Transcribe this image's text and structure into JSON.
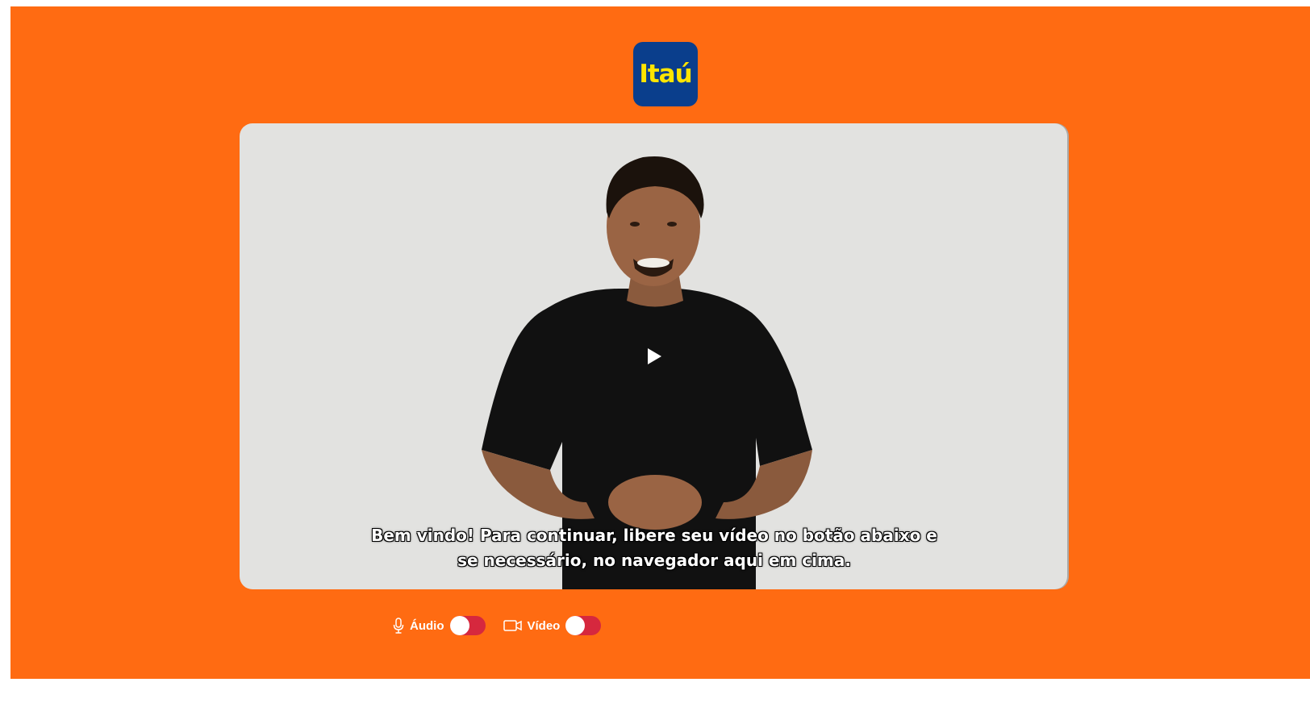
{
  "brand": {
    "logo_text": "Itaú",
    "logo_bg": "#0a3e8c",
    "logo_fg": "#ffe500",
    "page_bg": "#ff6b12"
  },
  "video": {
    "state": "paused",
    "play_icon": "play-icon",
    "subtitle_lines": [
      "Bem vindo! Para continuar, libere seu vídeo no botão abaixo e",
      "se necessário, no navegador aqui em cima."
    ]
  },
  "controls": {
    "audio": {
      "icon": "microphone-icon",
      "label": "Áudio",
      "enabled": false
    },
    "video": {
      "icon": "camera-icon",
      "label": "Vídeo",
      "enabled": false
    },
    "toggle_off_color": "#d6283e"
  }
}
